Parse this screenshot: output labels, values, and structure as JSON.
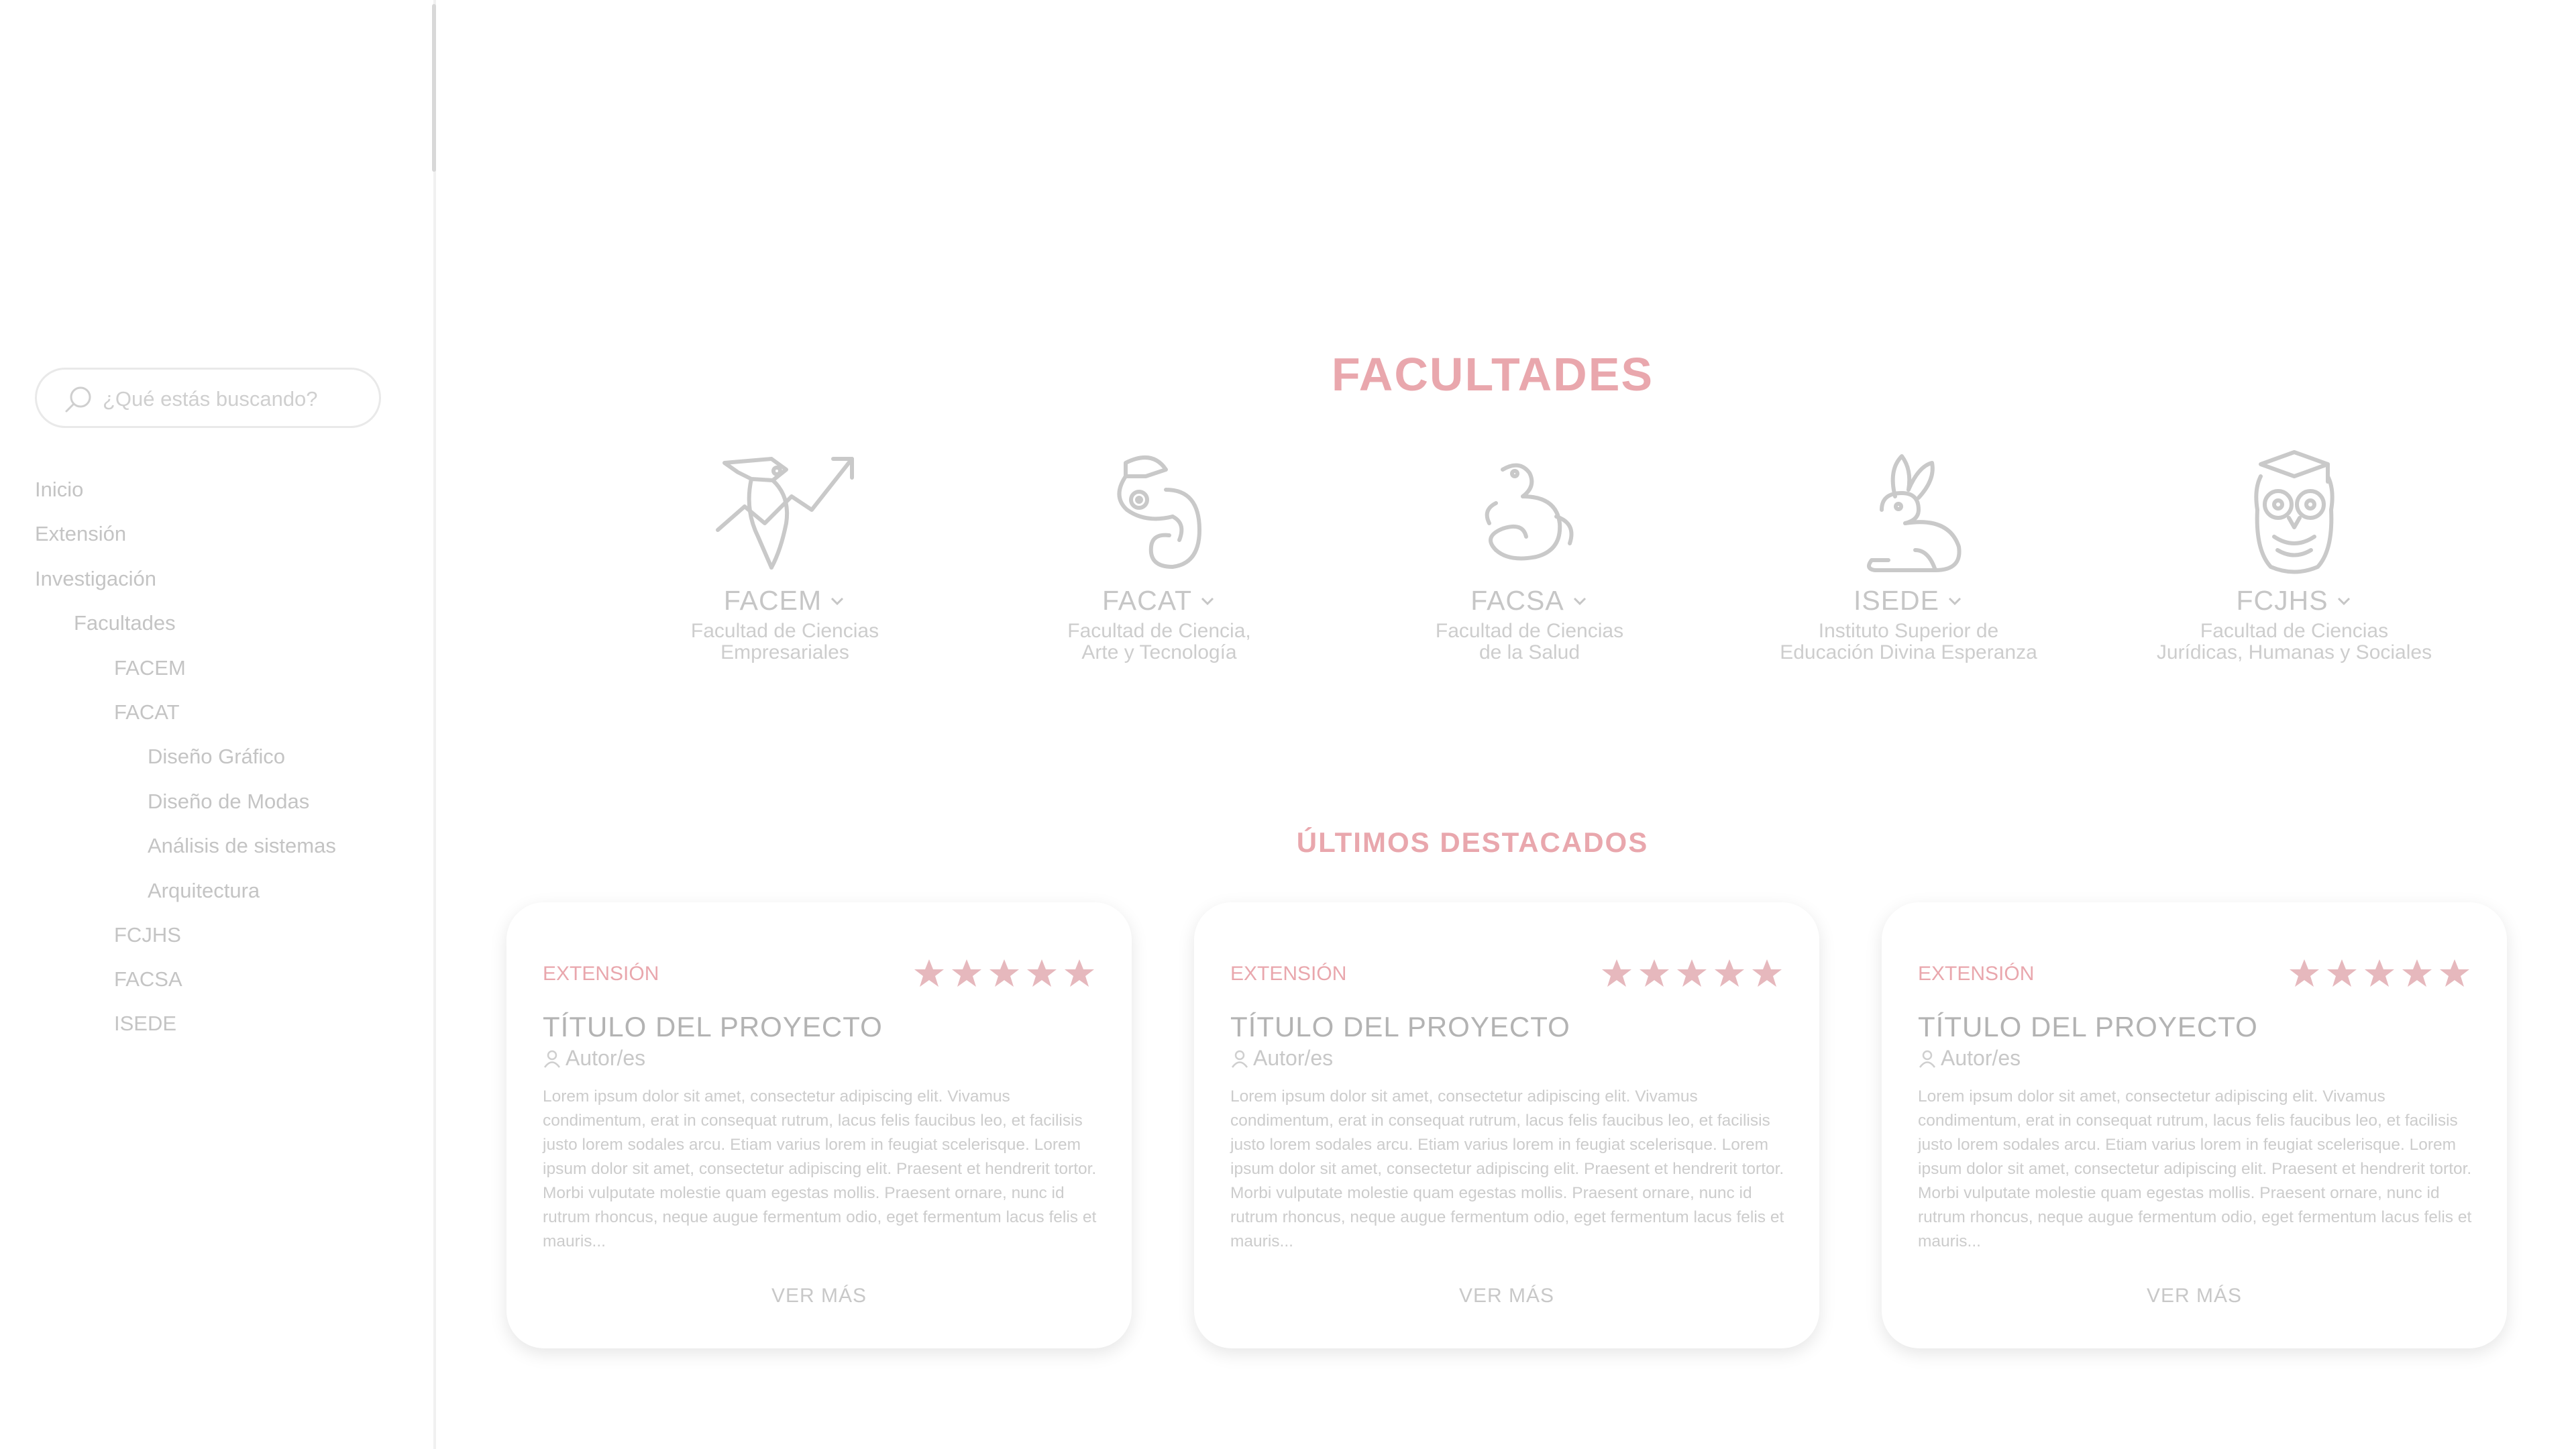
{
  "search": {
    "placeholder": "¿Qué estás buscando?"
  },
  "nav": {
    "items": [
      {
        "label": "Inicio"
      },
      {
        "label": "Extensión"
      },
      {
        "label": "Investigación"
      },
      {
        "label": "Facultades"
      },
      {
        "label": "FACEM"
      },
      {
        "label": "FACAT"
      },
      {
        "label": "Diseño Gráfico"
      },
      {
        "label": "Diseño de Modas"
      },
      {
        "label": "Análisis de sistemas"
      },
      {
        "label": "Arquitectura"
      },
      {
        "label": "FCJHS"
      },
      {
        "label": "FACSA"
      },
      {
        "label": "ISEDE"
      }
    ]
  },
  "facultades": {
    "title": "FACULTADES",
    "items": [
      {
        "code": "FACEM",
        "desc1": "Facultad de Ciencias",
        "desc2": "Empresariales",
        "icon": "toucan-icon"
      },
      {
        "code": "FACAT",
        "desc1": "Facultad de Ciencia,",
        "desc2": "Arte y Tecnología",
        "icon": "chameleon-icon"
      },
      {
        "code": "FACSA",
        "desc1": "Facultad de Ciencias",
        "desc2": "de la Salud",
        "icon": "snake-icon"
      },
      {
        "code": "ISEDE",
        "desc1": "Instituto Superior de",
        "desc2": "Educación Divina Esperanza",
        "icon": "rabbit-icon"
      },
      {
        "code": "FCJHS",
        "desc1": "Facultad de Ciencias",
        "desc2": "Jurídicas, Humanas y Sociales",
        "icon": "owl-icon"
      }
    ]
  },
  "destacados": {
    "title": "ÚLTIMOS DESTACADOS",
    "cards": [
      {
        "tag": "EXTENSIÓN",
        "title": "TÍTULO DEL PROYECTO",
        "author": "Autor/es",
        "rating": 5,
        "body": "Lorem ipsum dolor sit amet, consectetur adipiscing elit. Vivamus condimentum, erat in consequat rutrum, lacus felis faucibus leo, et facilisis justo lorem sodales arcu. Etiam varius lorem in feugiat scelerisque. Lorem ipsum dolor sit amet, consectetur adipiscing elit. Praesent et hendrerit tortor. Morbi vulputate molestie quam egestas mollis. Praesent ornare, nunc id rutrum rhoncus, neque augue fermentum odio, eget fermentum lacus felis et mauris...",
        "more": "VER MÁS"
      },
      {
        "tag": "EXTENSIÓN",
        "title": "TÍTULO DEL PROYECTO",
        "author": "Autor/es",
        "rating": 5,
        "body": "Lorem ipsum dolor sit amet, consectetur adipiscing elit. Vivamus condimentum, erat in consequat rutrum, lacus felis faucibus leo, et facilisis justo lorem sodales arcu. Etiam varius lorem in feugiat scelerisque. Lorem ipsum dolor sit amet, consectetur adipiscing elit. Praesent et hendrerit tortor. Morbi vulputate molestie quam egestas mollis. Praesent ornare, nunc id rutrum rhoncus, neque augue fermentum odio, eget fermentum lacus felis et mauris...",
        "more": "VER MÁS"
      },
      {
        "tag": "EXTENSIÓN",
        "title": "TÍTULO DEL PROYECTO",
        "author": "Autor/es",
        "rating": 5,
        "body": "Lorem ipsum dolor sit amet, consectetur adipiscing elit. Vivamus condimentum, erat in consequat rutrum, lacus felis faucibus leo, et facilisis justo lorem sodales arcu. Etiam varius lorem in feugiat scelerisque. Lorem ipsum dolor sit amet, consectetur adipiscing elit. Praesent et hendrerit tortor. Morbi vulputate molestie quam egestas mollis. Praesent ornare, nunc id rutrum rhoncus, neque augue fermentum odio, eget fermentum lacus felis et mauris...",
        "more": "VER MÁS"
      }
    ]
  },
  "colors": {
    "accent": "#e9a7ad",
    "text": "#c4c4c4",
    "icon": "#c9c9c9",
    "star": "#e6b8bd"
  }
}
